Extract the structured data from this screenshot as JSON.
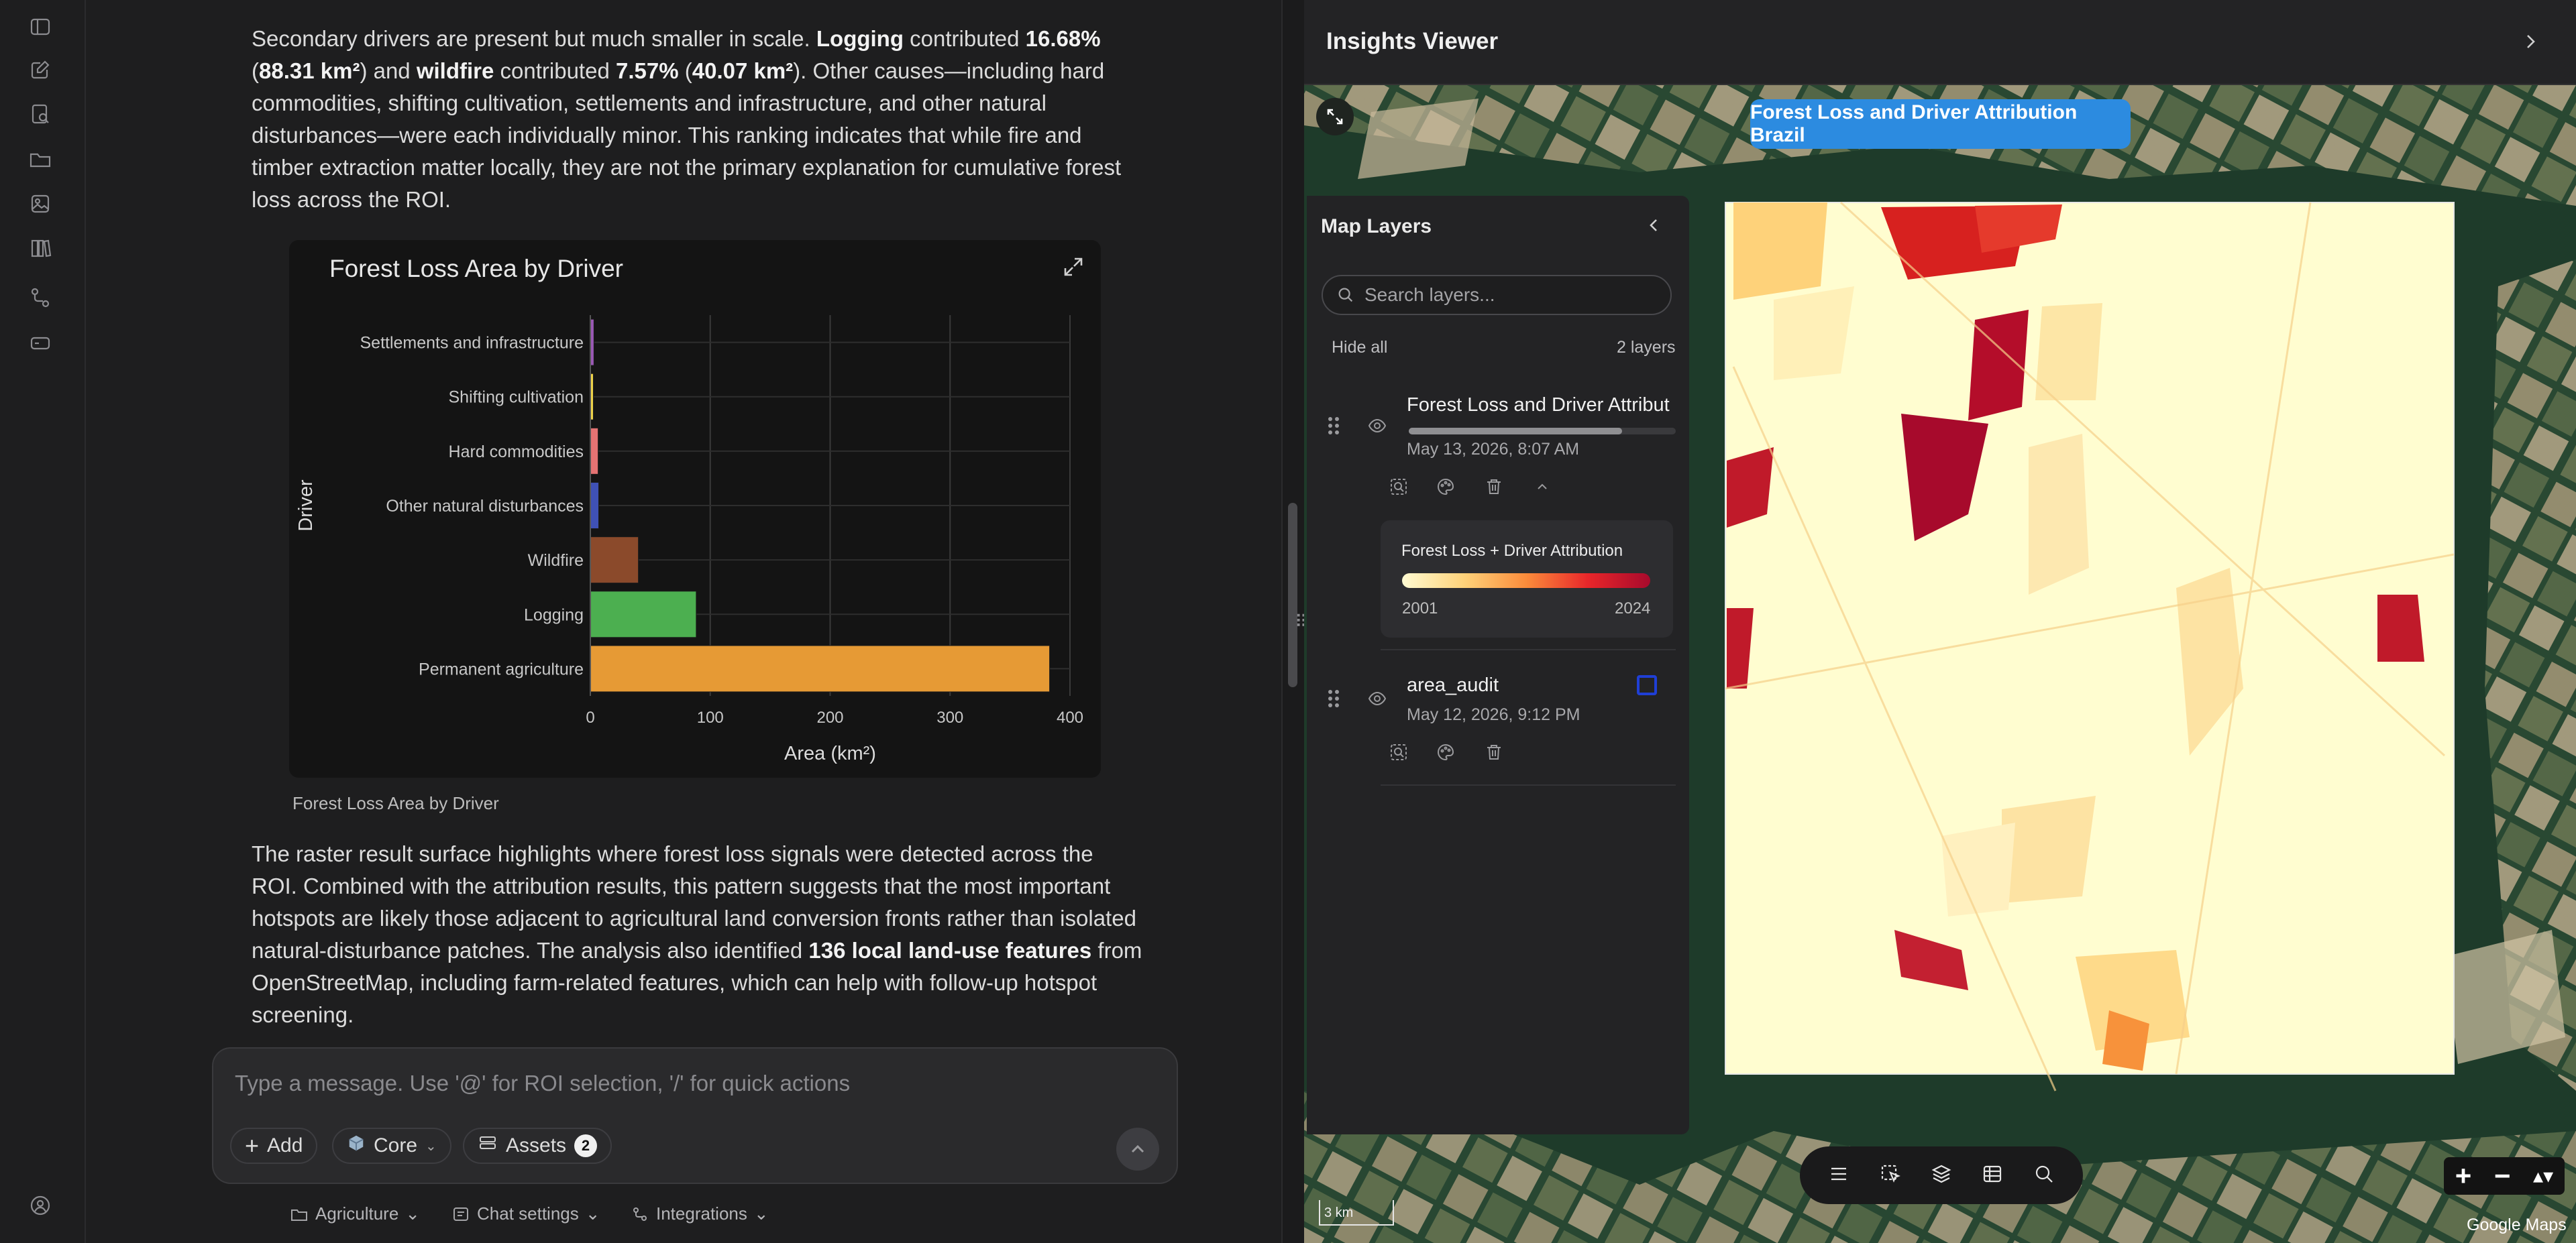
{
  "chat": {
    "para1": [
      {
        "t": "Secondary drivers are present but much smaller in scale. "
      },
      {
        "t": "Logging",
        "b": true
      },
      {
        "t": " contributed "
      },
      {
        "t": "16.68%",
        "b": true
      },
      {
        "t": " ("
      },
      {
        "t": "88.31 km²",
        "b": true
      },
      {
        "t": ") and "
      },
      {
        "t": "wildfire",
        "b": true
      },
      {
        "t": " contributed "
      },
      {
        "t": "7.57%",
        "b": true
      },
      {
        "t": " ("
      },
      {
        "t": "40.07 km²",
        "b": true
      },
      {
        "t": "). Other causes—including hard commodities, shifting cultivation, settlements and infrastructure, and other natural disturbances—were each individually minor. This ranking indicates that while fire and timber extraction matter locally, they are not the primary explanation for cumulative forest loss across the ROI."
      }
    ],
    "chart_caption": "Forest Loss Area by Driver",
    "para2": [
      {
        "t": "The raster result surface highlights where forest loss signals were detected across the ROI. Combined with the attribution results, this pattern suggests that the most important hotspots are likely those adjacent to agricultural land conversion fronts rather than isolated natural-disturbance patches. The analysis also identified "
      },
      {
        "t": "136 local land-use features",
        "b": true
      },
      {
        "t": " from OpenStreetMap, including farm-related features, which can help with follow-up hotspot screening."
      }
    ],
    "composer": {
      "placeholder": "Type a message. Use '@' for ROI selection, '/' for quick actions",
      "add_label": "Add",
      "core_label": "Core",
      "assets_label": "Assets",
      "assets_count": "2"
    },
    "footer": {
      "project": "Agriculture",
      "settings": "Chat settings",
      "integrations": "Integrations"
    }
  },
  "chart_data": {
    "type": "bar",
    "orientation": "horizontal",
    "title": "Forest Loss Area by Driver",
    "xlabel": "Area (km²)",
    "ylabel": "Driver",
    "xlim": [
      0,
      400
    ],
    "xticks": [
      0,
      100,
      200,
      300,
      400
    ],
    "grid": true,
    "categories": [
      "Settlements and infrastructure",
      "Shifting cultivation",
      "Hard commodities",
      "Other natural disturbances",
      "Wildfire",
      "Logging",
      "Permanent agriculture"
    ],
    "values": [
      3.0,
      2.5,
      6.5,
      7.0,
      40.07,
      88.31,
      383.0
    ],
    "colors": [
      "#9b59b6",
      "#f1d54a",
      "#e57373",
      "#3f51b5",
      "#8b4a2b",
      "#4caf50",
      "#e69a35"
    ]
  },
  "viewer": {
    "title": "Insights Viewer",
    "active_layer_pill": "Forest Loss and Driver Attribution Brazil",
    "layers_panel": {
      "title": "Map Layers",
      "search_placeholder": "Search layers...",
      "hide_all": "Hide all",
      "count": "2 layers",
      "layers": [
        {
          "name": "Forest Loss and Driver Attribut",
          "date": "May 13, 2026, 8:07 AM",
          "progress": 0.8
        },
        {
          "name": "area_audit",
          "date": "May 12, 2026, 9:12 PM",
          "swatch": "#1f3fd6"
        }
      ],
      "legend": {
        "title": "Forest Loss + Driver Attribution",
        "min": "2001",
        "max": "2024"
      }
    },
    "scale": "3 km",
    "attribution": "Google Maps",
    "zoom_in": "+",
    "zoom_out": "−"
  }
}
